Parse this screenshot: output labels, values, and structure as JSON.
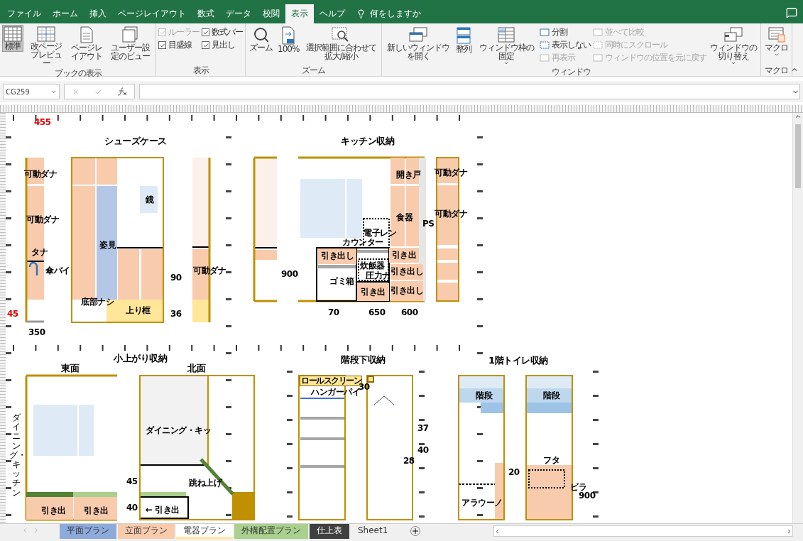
{
  "ribbon_tabs": [
    {
      "label": "ファイル",
      "selected": false
    },
    {
      "label": "ホーム",
      "selected": false
    },
    {
      "label": "挿入",
      "selected": false
    },
    {
      "label": "ページレイアウト",
      "selected": false
    },
    {
      "label": "数式",
      "selected": false
    },
    {
      "label": "データ",
      "selected": false
    },
    {
      "label": "校閲",
      "selected": false
    },
    {
      "label": "表示",
      "selected": true
    },
    {
      "label": "ヘルプ",
      "selected": false
    }
  ],
  "tell_me": "何をしますか",
  "ribbon_groups": [
    {
      "label": "ブックの表示",
      "items": [
        {
          "kind": "large",
          "label": "標準",
          "selected": true
        },
        {
          "kind": "large",
          "label": "改ページプレビュー",
          "selected": false
        },
        {
          "kind": "large",
          "label": "ページレイアウト",
          "selected": false
        },
        {
          "kind": "large",
          "label": "ユーザー設定のビュー",
          "selected": false
        }
      ]
    },
    {
      "label": "表示",
      "items": [
        {
          "kind": "stack",
          "items": [
            {
              "kind": "check",
              "label": "ルーラー",
              "checked": true,
              "disabled": true
            },
            {
              "kind": "check",
              "label": "目盛線",
              "checked": true,
              "disabled": false
            }
          ]
        },
        {
          "kind": "stack",
          "items": [
            {
              "kind": "check",
              "label": "数式バー",
              "checked": true,
              "disabled": false
            },
            {
              "kind": "check",
              "label": "見出し",
              "checked": true,
              "disabled": false
            }
          ]
        }
      ]
    },
    {
      "label": "ズーム",
      "items": [
        {
          "kind": "large",
          "label": "ズーム"
        },
        {
          "kind": "large",
          "label": "100%"
        },
        {
          "kind": "large",
          "label": "選択範囲に合わせて拡大/縮小"
        }
      ]
    },
    {
      "label": "ウィンドウ",
      "items": [
        {
          "kind": "large",
          "label": "新しいウィンドウを開く"
        },
        {
          "kind": "large",
          "label": "整列"
        },
        {
          "kind": "large",
          "label": "ウィンドウ枠の固定",
          "dropdown": true
        },
        {
          "kind": "stack",
          "items": [
            {
              "kind": "small",
              "label": "分割",
              "disabled": false
            },
            {
              "kind": "small",
              "label": "表示しない",
              "disabled": false
            },
            {
              "kind": "small",
              "label": "再表示",
              "disabled": true
            }
          ]
        },
        {
          "kind": "stack",
          "items": [
            {
              "kind": "small",
              "label": "並べて比較",
              "disabled": true
            },
            {
              "kind": "small",
              "label": "同時にスクロール",
              "disabled": true
            },
            {
              "kind": "small",
              "label": "ウィンドウの位置を元に戻す",
              "disabled": true
            }
          ]
        },
        {
          "kind": "large",
          "label": "ウィンドウの切り替え",
          "dropdown": true
        }
      ]
    },
    {
      "label": "マクロ",
      "items": [
        {
          "kind": "large",
          "label": "マクロ",
          "dropdown": true
        }
      ]
    }
  ],
  "name_box": "CG259",
  "drawing_labels": [
    {
      "text": "455",
      "kind": "mark"
    },
    {
      "text": "45",
      "kind": "mark"
    },
    {
      "text": "シューズケース",
      "kind": "title"
    },
    {
      "text": "可動ダナ",
      "kind": "note"
    },
    {
      "text": "可動ダナ",
      "kind": "note"
    },
    {
      "text": "タナ",
      "kind": "note"
    },
    {
      "text": "傘バイ",
      "kind": "note"
    },
    {
      "text": "鏡",
      "kind": "note"
    },
    {
      "text": "姿見",
      "kind": "note"
    },
    {
      "text": "底部ナシ",
      "kind": "note"
    },
    {
      "text": "上り框",
      "kind": "note"
    },
    {
      "text": "90",
      "kind": "dim"
    },
    {
      "text": "36",
      "kind": "dim"
    },
    {
      "text": "可動ダナ",
      "kind": "note"
    },
    {
      "text": "350",
      "kind": "dim"
    },
    {
      "text": "キッチン収納",
      "kind": "title"
    },
    {
      "text": "開き戸",
      "kind": "note"
    },
    {
      "text": "食器",
      "kind": "note"
    },
    {
      "text": "PS",
      "kind": "dim"
    },
    {
      "text": "可動ダナ",
      "kind": "note"
    },
    {
      "text": "可動ダナ",
      "kind": "note"
    },
    {
      "text": "電子レン",
      "kind": "note"
    },
    {
      "text": "カウンター",
      "kind": "note"
    },
    {
      "text": "引き出し",
      "kind": "drawer"
    },
    {
      "text": "引き出",
      "kind": "drawer"
    },
    {
      "text": "炊飯器",
      "kind": "note"
    },
    {
      "text": "圧力ナ",
      "kind": "note"
    },
    {
      "text": "引き出し",
      "kind": "drawer"
    },
    {
      "text": "ゴミ箱",
      "kind": "note"
    },
    {
      "text": "引き出",
      "kind": "drawer"
    },
    {
      "text": "引き出し",
      "kind": "drawer"
    },
    {
      "text": "900",
      "kind": "dim"
    },
    {
      "text": "70",
      "kind": "dim"
    },
    {
      "text": "650",
      "kind": "dim"
    },
    {
      "text": "600",
      "kind": "dim"
    },
    {
      "text": "小上がり収納",
      "kind": "title"
    },
    {
      "text": "東面",
      "kind": "title"
    },
    {
      "text": "北面",
      "kind": "title"
    },
    {
      "text": "ダイニング・キッチン",
      "kind": "vertical"
    },
    {
      "text": "ダイニング・キッ",
      "kind": "note"
    },
    {
      "text": "跳ね上げ",
      "kind": "note"
    },
    {
      "text": "引き出",
      "kind": "note"
    },
    {
      "text": "引き出",
      "kind": "note"
    },
    {
      "text": "← 引き出",
      "kind": "note"
    },
    {
      "text": "45",
      "kind": "dim"
    },
    {
      "text": "40",
      "kind": "dim"
    },
    {
      "text": "階段下収納",
      "kind": "title"
    },
    {
      "text": "ロールスクリーン",
      "kind": "banner"
    },
    {
      "text": "ハンガーパイ",
      "kind": "note"
    },
    {
      "text": "30",
      "kind": "dim"
    },
    {
      "text": "37",
      "kind": "dim"
    },
    {
      "text": "40",
      "kind": "dim"
    },
    {
      "text": "28",
      "kind": "dim"
    },
    {
      "text": "1階トイレ収納",
      "kind": "title"
    },
    {
      "text": "階段",
      "kind": "note"
    },
    {
      "text": "階段",
      "kind": "note"
    },
    {
      "text": "20",
      "kind": "dim"
    },
    {
      "text": "フタ",
      "kind": "note"
    },
    {
      "text": "アラウーノ",
      "kind": "note"
    },
    {
      "text": "ビラ",
      "kind": "note"
    },
    {
      "text": "900",
      "kind": "dim"
    }
  ],
  "sheet_tabs": [
    {
      "label": "平面プラン",
      "color": "#8eaadb",
      "selected": false
    },
    {
      "label": "立面プラン",
      "color": "#f8cbad",
      "selected": false
    },
    {
      "label": "電器プラン",
      "color": "#ffe699",
      "selected": true
    },
    {
      "label": "外構配置プラン",
      "color": "#a9d08e",
      "selected": false
    },
    {
      "label": "仕上表",
      "color": "#404040",
      "selected": false
    },
    {
      "label": "Sheet1",
      "selected": false
    }
  ]
}
